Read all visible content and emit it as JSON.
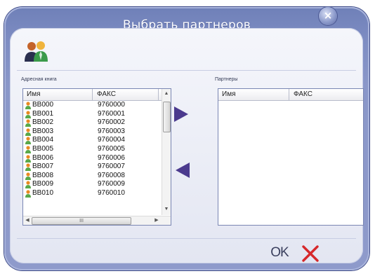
{
  "dialog": {
    "title": "Выбрать партнеров",
    "close_glyph": "×"
  },
  "address_book": {
    "label": "Адресная книга",
    "columns": [
      "Имя",
      "ФАКС"
    ],
    "rows": [
      {
        "name": "BB000",
        "fax": "9760000"
      },
      {
        "name": "BB001",
        "fax": "9760001"
      },
      {
        "name": "BB002",
        "fax": "9760002"
      },
      {
        "name": "BB003",
        "fax": "9760003"
      },
      {
        "name": "BB004",
        "fax": "9760004"
      },
      {
        "name": "BB005",
        "fax": "9760005"
      },
      {
        "name": "BB006",
        "fax": "9760006"
      },
      {
        "name": "BB007",
        "fax": "9760007"
      },
      {
        "name": "BB008",
        "fax": "9760008"
      },
      {
        "name": "BB009",
        "fax": "9760009"
      },
      {
        "name": "BB010",
        "fax": "9760010"
      }
    ],
    "hscroll_grip": "III"
  },
  "partners": {
    "label": "Партнеры",
    "columns": [
      "Имя",
      "ФАКС"
    ]
  },
  "buttons": {
    "ok_label": "OK",
    "add_arrow": "add-to-partners-arrow",
    "remove_arrow": "remove-from-partners-arrow",
    "cancel_icon": "red-x-icon"
  },
  "colors": {
    "dialog_frame": "#7d8cc2",
    "arrow": "#4b3a8e",
    "cancel_red": "#d6282b",
    "person_orange": "#e98a22",
    "person_green": "#59a84a"
  }
}
